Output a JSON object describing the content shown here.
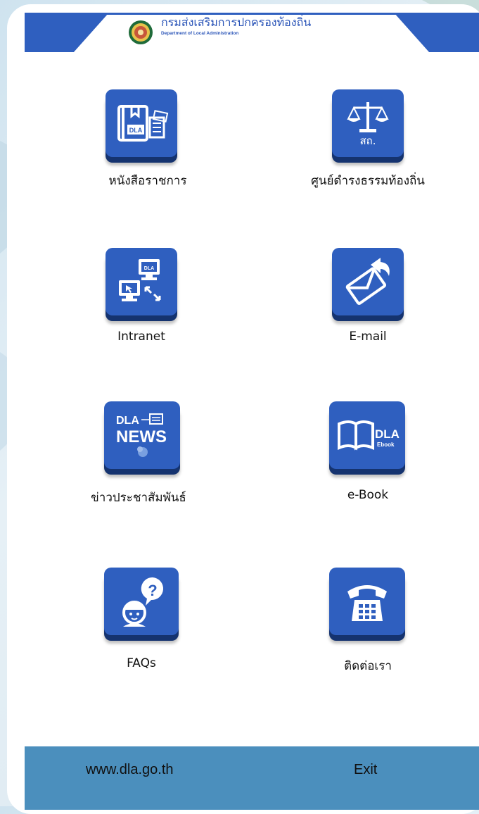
{
  "header": {
    "org_name": "กรมส่งเสริมการปกครองท้องถิ่น",
    "org_subtitle": "Department of Local Administration",
    "bar_color": "#2f5fbf"
  },
  "menu": {
    "items": [
      {
        "label": "หนังสือราชการ",
        "icon": "book-document-icon",
        "badge": "DLA"
      },
      {
        "label": "ศูนย์ดำรงธรรมท้องถิ่น",
        "icon": "scale-justice-icon",
        "badge": "สถ."
      },
      {
        "label": "Intranet",
        "icon": "network-computers-icon",
        "badge": "DLA"
      },
      {
        "label": "E-mail",
        "icon": "envelope-reply-icon"
      },
      {
        "label": "ข่าวประชาสัมพันธ์",
        "icon": "news-icon",
        "badge": "DLA",
        "badge2": "NEWS"
      },
      {
        "label": "e-Book",
        "icon": "open-book-icon",
        "badge": "DLA",
        "badge2": "Ebook"
      },
      {
        "label": "FAQs",
        "icon": "question-person-icon"
      },
      {
        "label": "ติดต่อเรา",
        "icon": "telephone-icon"
      }
    ]
  },
  "footer": {
    "website": "www.dla.go.th",
    "exit_label": "Exit",
    "color": "#4b8fbd"
  }
}
